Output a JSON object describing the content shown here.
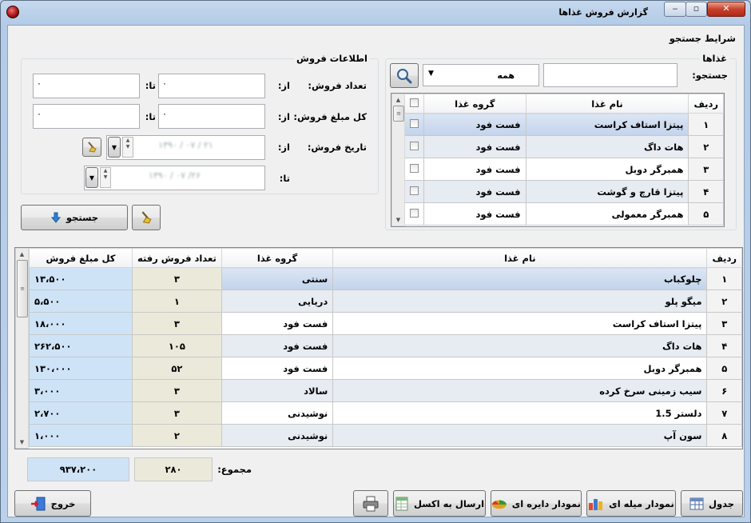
{
  "window": {
    "title": "گزارش فروش غذاها",
    "min": "‒",
    "max": "▫",
    "close": "✕"
  },
  "search_conditions": {
    "label": "شرایط جستجو"
  },
  "foods_group": {
    "title": "غذاها",
    "search_label": "جستجو:",
    "search_value": "",
    "group_combo": "همه",
    "columns": {
      "row": "ردیف",
      "name": "نام غذا",
      "group": "گروه غذا"
    },
    "rows": [
      {
        "row": "۱",
        "name": "پیتزا استاف کراست",
        "group": "فست فود"
      },
      {
        "row": "۲",
        "name": "هات داگ",
        "group": "فست فود"
      },
      {
        "row": "۳",
        "name": "همبرگر دوبل",
        "group": "فست فود"
      },
      {
        "row": "۴",
        "name": "پیتزا قارچ و گوشت",
        "group": "فست فود"
      },
      {
        "row": "۵",
        "name": "همبرگر معمولی",
        "group": "فست فود"
      }
    ]
  },
  "sales_info": {
    "title": "اطلاعات فروش",
    "count_label": "تعداد فروش:",
    "amount_label": "کل مبلغ فروش:",
    "date_label": "تاریخ فروش:",
    "from": "از:",
    "to": "تا:",
    "count_from": "۰",
    "count_to": "۰",
    "amount_from": "۰",
    "amount_to": "۰",
    "date_from": "۱۳۹۰ / ۰۷ / ۲۱",
    "date_to": "۱۳۹۰ / ۰۷ /۲۶"
  },
  "search_button": "جستجو",
  "report": {
    "columns": {
      "row": "ردیف",
      "name": "نام غذا",
      "group": "گروه غذا",
      "count": "تعداد فروش رفته",
      "total": "کل مبلغ فروش"
    },
    "rows": [
      {
        "row": "۱",
        "name": "چلوکباب",
        "group": "سنتی",
        "count": "۳",
        "total": "۱۳،۵۰۰"
      },
      {
        "row": "۲",
        "name": "میگو پلو",
        "group": "دریایی",
        "count": "۱",
        "total": "۵،۵۰۰"
      },
      {
        "row": "۳",
        "name": "پیتزا استاف کراست",
        "group": "فست فود",
        "count": "۳",
        "total": "۱۸،۰۰۰"
      },
      {
        "row": "۴",
        "name": "هات داگ",
        "group": "فست فود",
        "count": "۱۰۵",
        "total": "۲۶۲،۵۰۰"
      },
      {
        "row": "۵",
        "name": "همبرگر دوبل",
        "group": "فست فود",
        "count": "۵۲",
        "total": "۱۳۰،۰۰۰"
      },
      {
        "row": "۶",
        "name": "سیب زمینی سرخ کرده",
        "group": "سالاد",
        "count": "۳",
        "total": "۳،۰۰۰"
      },
      {
        "row": "۷",
        "name": "دلستر 1.5",
        "group": "نوشیدنی",
        "count": "۳",
        "total": "۲،۷۰۰"
      },
      {
        "row": "۸",
        "name": "سون آپ",
        "group": "نوشیدنی",
        "count": "۲",
        "total": "۱،۰۰۰"
      }
    ],
    "sum_label": "مجموع:",
    "sum_count": "۲۸۰",
    "sum_total": "۹۳۷،۲۰۰"
  },
  "footer": {
    "table": "جدول",
    "bar_chart": "نمودار میله ای",
    "pie_chart": "نمودار دایره ای",
    "excel": "ارسال به اکسل",
    "exit": "خروج"
  }
}
